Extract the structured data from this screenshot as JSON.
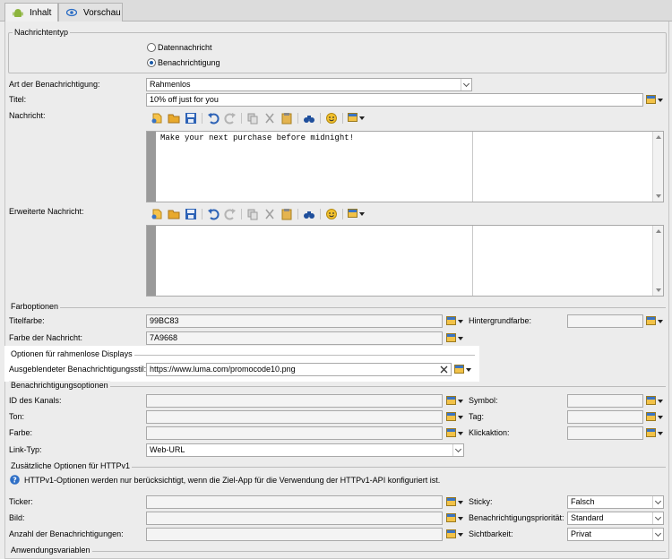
{
  "tabs": [
    {
      "label": "Inhalt",
      "icon": "android-icon"
    },
    {
      "label": "Vorschau",
      "icon": "eye-icon"
    }
  ],
  "message_type": {
    "legend": "Nachrichtentyp",
    "options": [
      {
        "label": "Datennachricht",
        "selected": false
      },
      {
        "label": "Benachrichtigung",
        "selected": true
      }
    ]
  },
  "form": {
    "notification_type_label": "Art der Benachrichtigung:",
    "notification_type_value": "Rahmenlos",
    "title_label": "Titel:",
    "title_value": "10% off just for you",
    "message_label": "Nachricht:",
    "message_value": "Make your next purchase before midnight!",
    "extended_label": "Erweiterte Nachricht:",
    "extended_value": ""
  },
  "colors": {
    "legend": "Farboptionen",
    "title_color_label": "Titelfarbe:",
    "title_color_value": "99BC83",
    "message_color_label": "Farbe der Nachricht:",
    "message_color_value": "7A9668",
    "background_color_label": "Hintergrundfarbe:",
    "background_color_value": ""
  },
  "borderless": {
    "legend": "Optionen für rahmenlose Displays",
    "hidden_style_label": "Ausgeblendeter Benachrichtigungsstil:",
    "hidden_style_value": "https://www.luma.com/promocode10.png"
  },
  "notif_options": {
    "legend": "Benachrichtigungsoptionen",
    "channel_id_label": "ID des Kanals:",
    "sound_label": "Ton:",
    "color_label": "Farbe:",
    "link_type_label": "Link-Typ:",
    "link_type_value": "Web-URL",
    "symbol_label": "Symbol:",
    "tag_label": "Tag:",
    "click_action_label": "Klickaktion:"
  },
  "httpv1": {
    "legend": "Zusätzliche Optionen für HTTPv1",
    "info": "HTTPv1-Optionen werden nur berücksichtigt, wenn die Ziel-App für die Verwendung der HTTPv1-API konfiguriert ist.",
    "ticker_label": "Ticker:",
    "image_label": "Bild:",
    "count_label": "Anzahl der Benachrichtigungen:",
    "sticky_label": "Sticky:",
    "sticky_value": "Falsch",
    "priority_label": "Benachrichtigungspriorität:",
    "priority_value": "Standard",
    "visibility_label": "Sichtbarkeit:",
    "visibility_value": "Privat"
  },
  "app_vars": {
    "legend": "Anwendungsvariablen"
  },
  "accent_colors": {
    "highlight": "#ffffff",
    "panel": "#ececec",
    "link": "#1a5aa8"
  }
}
